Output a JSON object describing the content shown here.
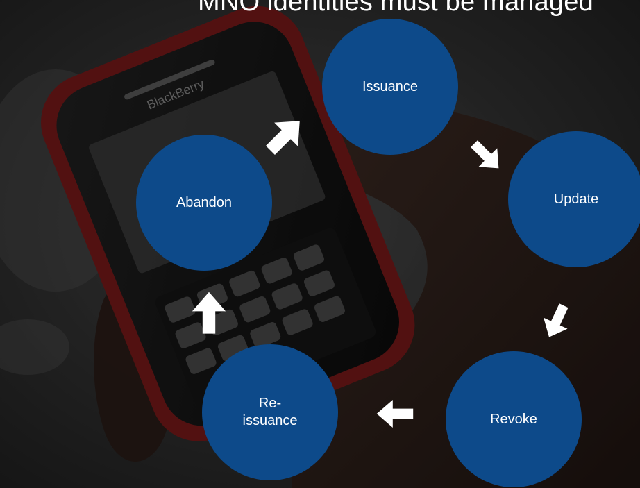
{
  "title": "MNO identities must be managed",
  "colors": {
    "stage_fill": "#0d4a8a",
    "arrow_fill": "#ffffff",
    "background": "#3a3a3a"
  },
  "stages": {
    "issuance": "Issuance",
    "update": "Update",
    "revoke": "Revoke",
    "reissuance_line1": "Re-",
    "reissuance_line2": "issuance",
    "abandon": "Abandon"
  },
  "arrows": [
    "issuance-to-update",
    "update-to-revoke",
    "revoke-to-reissuance",
    "reissuance-to-abandon",
    "abandon-to-issuance"
  ],
  "background_photo": "hand-holding-blackberry-phone",
  "phone_brand": "BlackBerry"
}
